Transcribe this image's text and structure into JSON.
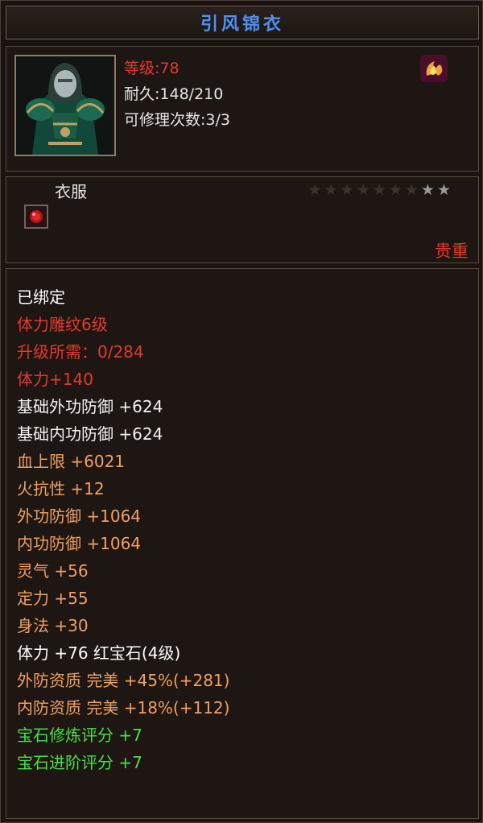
{
  "title": "引风锦衣",
  "header": {
    "level_label": "等级",
    "level_value": ":78",
    "durability": "耐久:148/210",
    "repairs": "可修理次数:3/3",
    "top_icon": "flame-dragon-icon",
    "portrait": "armor-portrait-icon"
  },
  "type_section": {
    "type": "衣服",
    "stars_total": 9,
    "stars_lit": 2,
    "socket_icon": "ruby-gem-icon",
    "rarity": "贵重"
  },
  "attributes": [
    {
      "text": "已绑定",
      "color": "#ffffff"
    },
    {
      "text": "体力雕纹6级",
      "color": "#e23a2e"
    },
    {
      "text": "升级所需：0/284",
      "color": "#e23a2e"
    },
    {
      "text": "体力+140",
      "color": "#e23a2e"
    },
    {
      "text": "基础外功防御 +624",
      "color": "#f2f2f2"
    },
    {
      "text": "基础内功防御 +624",
      "color": "#f2f2f2"
    },
    {
      "text": "血上限 +6021",
      "color": "#f0a060"
    },
    {
      "text": "火抗性 +12",
      "color": "#f0a060"
    },
    {
      "text": "外功防御 +1064",
      "color": "#f0a060"
    },
    {
      "text": "内功防御 +1064",
      "color": "#f0a060"
    },
    {
      "text": "灵气 +56",
      "color": "#f0a060"
    },
    {
      "text": "定力 +55",
      "color": "#f0a060"
    },
    {
      "text": "身法 +30",
      "color": "#f0a060"
    },
    {
      "text": "体力 +76 红宝石(4级)",
      "color": "#ffffff"
    },
    {
      "text": "外防资质  完美 +45%(+281)",
      "color": "#f0a060"
    },
    {
      "text": "内防资质  完美 +18%(+112)",
      "color": "#f0a060"
    },
    {
      "text": "宝石修炼评分 +7",
      "color": "#48e048"
    },
    {
      "text": "宝石进阶评分 +7",
      "color": "#48e048"
    }
  ]
}
